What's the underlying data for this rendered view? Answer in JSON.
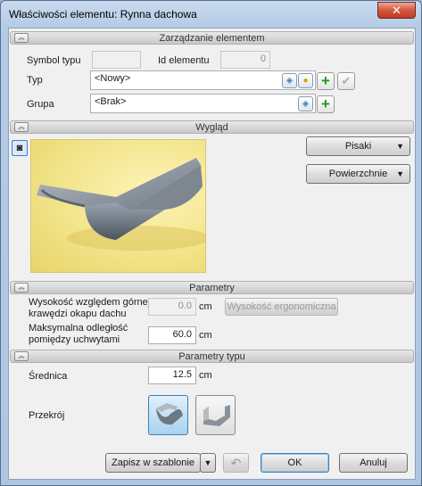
{
  "window": {
    "title": "Właściwości elementu: Rynna dachowa",
    "close_glyph": "✕"
  },
  "sections": {
    "management": "Zarządzanie elementem",
    "appearance": "Wygląd",
    "parameters": "Parametry",
    "type_parameters": "Parametry typu"
  },
  "management": {
    "symbol_label": "Symbol typu",
    "symbol_value": "",
    "id_label": "Id elementu",
    "id_value": "0",
    "type_label": "Typ",
    "type_value": "<Nowy>",
    "group_label": "Grupa",
    "group_value": "<Brak>"
  },
  "appearance": {
    "pens_button": "Pisaki",
    "surfaces_button": "Powierzchnie"
  },
  "parameters": {
    "height_label_line1": "Wysokość względem górnej",
    "height_label_line2": "krawędzi okapu dachu",
    "height_value": "0.0",
    "height_unit": "cm",
    "ergonomic_button": "Wysokość ergonomiczna",
    "distance_label_line1": "Maksymalna odległość",
    "distance_label_line2": "pomiędzy uchwytami",
    "distance_value": "60.0",
    "distance_unit": "cm"
  },
  "type_parameters": {
    "diameter_label": "Średnica",
    "diameter_value": "12.5",
    "diameter_unit": "cm",
    "section_label": "Przekrój"
  },
  "footer": {
    "save_template": "Zapisz w szablonie",
    "ok": "OK",
    "cancel": "Anuluj"
  },
  "icons": {
    "collapse": "chevron-up-icon",
    "plus": "add-icon",
    "check": "check-icon",
    "camera": "camera-icon",
    "undo": "undo-icon"
  },
  "colors": {
    "accent": "#3c7fb1",
    "plus_green": "#1e9a1e",
    "preview_bg": "#f2e48a"
  }
}
